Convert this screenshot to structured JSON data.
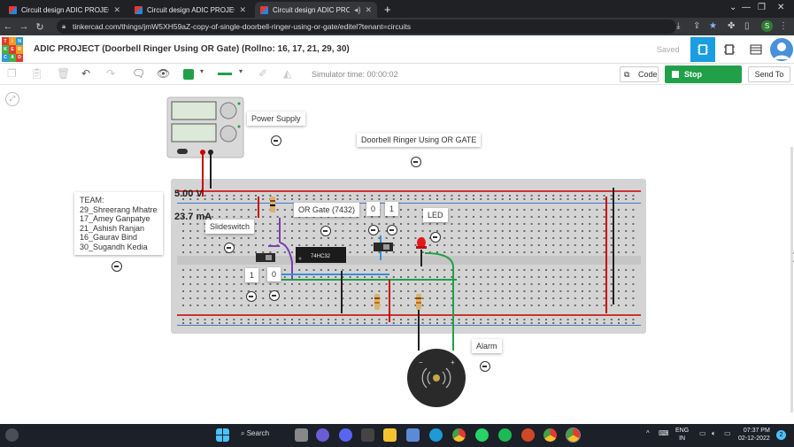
{
  "browser": {
    "tabs": [
      {
        "label": "Circuit design ADIC PROJECT (Ter",
        "active": false
      },
      {
        "label": "Circuit design ADIC PROJECT (Bu",
        "active": false
      },
      {
        "label": "Circuit design ADIC PROJECT",
        "active": true
      }
    ],
    "url": "tinkercad.com/things/jmW5XH59aZ-copy-of-single-doorbell-ringer-using-or-gate/editel?tenant=circuits"
  },
  "header": {
    "logo_letters": [
      "TIN",
      "KER",
      "CAD"
    ],
    "project_title": "ADIC PROJECT (Doorbell Ringer Using OR Gate) (Rollno: 16, 17, 21, 29, 30)",
    "saved_label": "Saved",
    "colors": {
      "accent": "#1a9de1",
      "stop": "#21a04a"
    }
  },
  "toolbar": {
    "simulator_time": "Simulator time: 00:00:02",
    "code_label": "Code",
    "stop_label": "Stop Simulation",
    "send_label": "Send To",
    "fill_color": "#21a04a",
    "line_color": "#21a04a"
  },
  "circuit": {
    "power_supply": {
      "voltage": "5.00 V",
      "current": "23.7 mA"
    },
    "notes": {
      "power_supply": "Power Supply",
      "title": "Doorbell Ringer Using OR GATE",
      "team_header": "TEAM:",
      "team": [
        "29_Shreerang Mhatre",
        "17_Amey Ganpatye",
        "21_Ashish Ranjan",
        "16_Gaurav Bind",
        "30_Sugandh Kedia"
      ],
      "or_gate": "OR Gate (7432)",
      "slideswitch": "Slideswitch",
      "in_a_top": "0",
      "in_b_top": "1",
      "in_a_bottom": "1",
      "in_b_bottom": "0",
      "led": "LED",
      "alarm": "Alarm"
    },
    "chip_label": "74HC32"
  },
  "taskbar": {
    "search_label": "Search",
    "lang_top": "ENG",
    "lang_bottom": "IN",
    "time": "07:37 PM",
    "date": "02-12-2022",
    "notification_count": "2"
  }
}
